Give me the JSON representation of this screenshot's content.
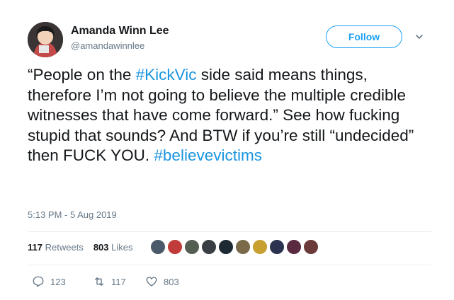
{
  "user": {
    "name": "Amanda Winn Lee",
    "handle": "@amandawinnlee"
  },
  "follow_label": "Follow",
  "tweet": {
    "part1": "“People on the ",
    "hashtag1": "#KickVic",
    "part2": " side said means things, therefore I’m not going to believe the multiple credible witnesses that have come forward.” See how fucking stupid that sounds? And BTW if you’re still “undecided” then FUCK YOU.  ",
    "hashtag2": "#believevictims"
  },
  "timestamp": "5:13 PM - 5 Aug 2019",
  "stats": {
    "retweets_count": "117",
    "retweets_label": "Retweets",
    "likes_count": "803",
    "likes_label": "Likes"
  },
  "liker_colors": [
    "#4a5a6a",
    "#c23b3b",
    "#555e52",
    "#3a3f46",
    "#1e2a33",
    "#7a6a4a",
    "#c8a030",
    "#2b3350",
    "#5a2a40",
    "#6b3a3a"
  ],
  "actions": {
    "reply_count": "123",
    "retweet_count": "117",
    "like_count": "803"
  },
  "colors": {
    "accent": "#1da1f2",
    "hashtag": "#1b95e0",
    "muted": "#657786"
  }
}
